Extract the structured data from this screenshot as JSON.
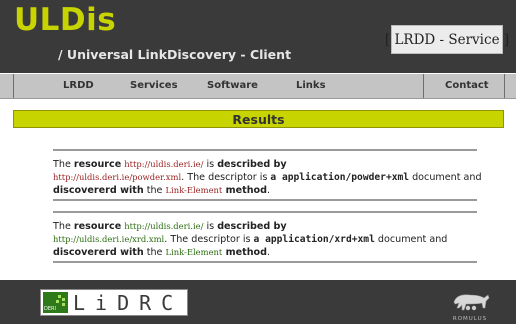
{
  "header": {
    "logo": "ULDis",
    "subtitle": "/ Universal LinkDiscovery - Client",
    "badge": "[ LRDD - Service ]"
  },
  "nav": {
    "items": [
      {
        "label": "LRDD"
      },
      {
        "label": "Services"
      },
      {
        "label": "Software"
      },
      {
        "label": "Links"
      },
      {
        "label": "Contact"
      }
    ]
  },
  "results": {
    "title": "Results",
    "items": [
      {
        "resource_prefix": "The ",
        "resource_word": "resource",
        "resource_url": "http://uldis.deri.ie/",
        "is": " is ",
        "described_by": "described by",
        "descriptor_url": "http://uldis.deri.ie/powder.xml",
        "descriptor_text": ". The descriptor is ",
        "a_app": "a application/powder+xml",
        "doc_and": " document and",
        "discovered_with": "discovererd with",
        "the": " the ",
        "link_element": "Link-Element",
        "method": " method",
        "period": "."
      },
      {
        "resource_prefix": "The ",
        "resource_word": "resource",
        "resource_url": "http://uldis.deri.ie/",
        "is": " is ",
        "described_by": "described by",
        "descriptor_url": "http://uldis.deri.ie/xrd.xml",
        "descriptor_text": ". The descriptor is ",
        "a_app": "a application/xrd+xml",
        "doc_and": " document and",
        "discovered_with": "discovererd with",
        "the": " the ",
        "link_element": "Link-Element",
        "method": " method",
        "period": "."
      }
    ]
  },
  "footer": {
    "lidrc_logo": "LiDRC",
    "lidrc_tag": "DERI",
    "romulus_label": "ROMULUS"
  },
  "colors": {
    "accent": "#c8d400",
    "dark": "#3a3a3a",
    "nav": "#c4c4c4",
    "link_red": "#9a1f1f",
    "link_green": "#2b6e10"
  }
}
